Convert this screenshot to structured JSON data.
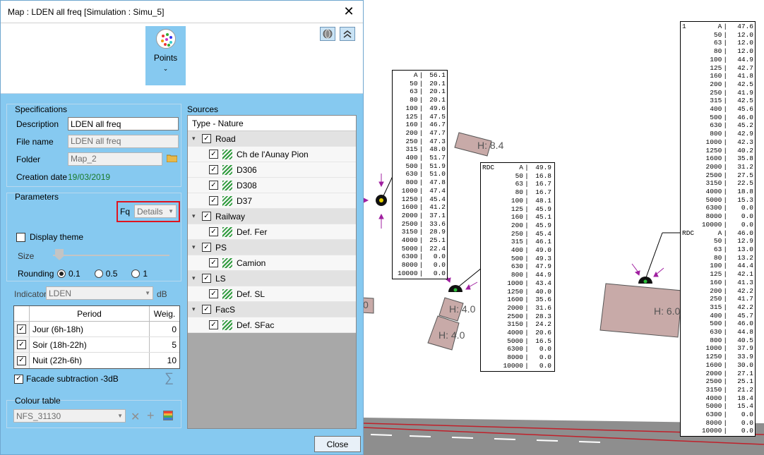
{
  "window": {
    "title": "Map : LDEN all freq [Simulation : Simu_5]",
    "close_glyph": "✕"
  },
  "ribbon": {
    "points_label": "Points",
    "points_chevron": "⌄",
    "icons": [
      "globe-icon",
      "collapse-up-icon"
    ]
  },
  "specifications": {
    "group_label": "Specifications",
    "description_label": "Description",
    "description_value": "LDEN all freq",
    "file_name_label": "File name",
    "file_name_value": "LDEN all freq",
    "folder_label": "Folder",
    "folder_value": "Map_2",
    "creation_date_label": "Creation date",
    "creation_date_value": "19/03/2019"
  },
  "parameters": {
    "group_label": "Parameters",
    "fq_label": "Fq",
    "fq_value": "Details",
    "display_theme_label": "Display theme",
    "size_label": "Size",
    "rounding_label": "Rounding",
    "rounding_options": [
      "0.1",
      "0.5",
      "1"
    ],
    "rounding_selected": "0.1"
  },
  "indicator": {
    "label": "Indicator",
    "value": "LDEN",
    "unit": "dB"
  },
  "periods": {
    "col_period": "Period",
    "col_weight": "Weig.",
    "rows": [
      {
        "name": "Jour (6h-18h)",
        "weight": "0",
        "checked": true
      },
      {
        "name": "Soir (18h-22h)",
        "weight": "5",
        "checked": true
      },
      {
        "name": "Nuit (22h-6h)",
        "weight": "10",
        "checked": true
      }
    ]
  },
  "facade": {
    "label": "Facade subtraction -3dB",
    "checked": true,
    "sigma": "∑"
  },
  "colour_table": {
    "group_label": "Colour table",
    "value": "NFS_31130"
  },
  "sources": {
    "group_label": "Sources",
    "header": "Type - Nature",
    "groups": [
      {
        "name": "Road",
        "children": [
          "Ch de l'Aunay Pion",
          "D306",
          "D308",
          "D37"
        ]
      },
      {
        "name": "Railway",
        "children": [
          "Def. Fer"
        ]
      },
      {
        "name": "PS",
        "children": [
          "Camion"
        ]
      },
      {
        "name": "LS",
        "children": [
          "Def. SL"
        ]
      },
      {
        "name": "FacS",
        "children": [
          "Def. SFac"
        ]
      }
    ]
  },
  "close_button": "Close",
  "map": {
    "labels": [
      "H: 8.4",
      "H: 4.0",
      "H: 4.0",
      "H: 6.0",
      "0"
    ],
    "table_a": {
      "rows": [
        [
          "A",
          "56.1"
        ],
        [
          "50",
          "20.1"
        ],
        [
          "63",
          "20.1"
        ],
        [
          "80",
          "20.1"
        ],
        [
          "100",
          "49.6"
        ],
        [
          "125",
          "47.5"
        ],
        [
          "160",
          "46.7"
        ],
        [
          "200",
          "47.7"
        ],
        [
          "250",
          "47.3"
        ],
        [
          "315",
          "48.0"
        ],
        [
          "400",
          "51.7"
        ],
        [
          "500",
          "51.9"
        ],
        [
          "630",
          "51.0"
        ],
        [
          "800",
          "47.8"
        ],
        [
          "1000",
          "47.4"
        ],
        [
          "1250",
          "45.4"
        ],
        [
          "1600",
          "41.2"
        ],
        [
          "2000",
          "37.1"
        ],
        [
          "2500",
          "33.6"
        ],
        [
          "3150",
          "28.9"
        ],
        [
          "4000",
          "25.1"
        ],
        [
          "5000",
          "22.4"
        ],
        [
          "6300",
          "0.0"
        ],
        [
          "8000",
          "0.0"
        ],
        [
          "10000",
          "0.0"
        ]
      ]
    },
    "table_b": {
      "level": "RDC",
      "rows": [
        [
          "A",
          "49.9"
        ],
        [
          "50",
          "16.8"
        ],
        [
          "63",
          "16.7"
        ],
        [
          "80",
          "16.7"
        ],
        [
          "100",
          "48.1"
        ],
        [
          "125",
          "45.9"
        ],
        [
          "160",
          "45.1"
        ],
        [
          "200",
          "45.9"
        ],
        [
          "250",
          "45.4"
        ],
        [
          "315",
          "46.1"
        ],
        [
          "400",
          "49.0"
        ],
        [
          "500",
          "49.3"
        ],
        [
          "630",
          "47.9"
        ],
        [
          "800",
          "44.9"
        ],
        [
          "1000",
          "43.4"
        ],
        [
          "1250",
          "40.0"
        ],
        [
          "1600",
          "35.6"
        ],
        [
          "2000",
          "31.6"
        ],
        [
          "2500",
          "28.3"
        ],
        [
          "3150",
          "24.2"
        ],
        [
          "4000",
          "20.6"
        ],
        [
          "5000",
          "16.5"
        ],
        [
          "6300",
          "0.0"
        ],
        [
          "8000",
          "0.0"
        ],
        [
          "10000",
          "0.0"
        ]
      ]
    },
    "table_c": {
      "level1": "1",
      "rows1": [
        [
          "A",
          "47.6"
        ],
        [
          "50",
          "12.0"
        ],
        [
          "63",
          "12.0"
        ],
        [
          "80",
          "12.0"
        ],
        [
          "100",
          "44.9"
        ],
        [
          "125",
          "42.7"
        ],
        [
          "160",
          "41.8"
        ],
        [
          "200",
          "42.5"
        ],
        [
          "250",
          "41.9"
        ],
        [
          "315",
          "42.5"
        ],
        [
          "400",
          "45.6"
        ],
        [
          "500",
          "46.0"
        ],
        [
          "630",
          "45.2"
        ],
        [
          "800",
          "42.9"
        ],
        [
          "1000",
          "42.3"
        ],
        [
          "1250",
          "40.2"
        ],
        [
          "1600",
          "35.8"
        ],
        [
          "2000",
          "31.2"
        ],
        [
          "2500",
          "27.5"
        ],
        [
          "3150",
          "22.5"
        ],
        [
          "4000",
          "18.8"
        ],
        [
          "5000",
          "15.3"
        ],
        [
          "6300",
          "0.0"
        ],
        [
          "8000",
          "0.0"
        ],
        [
          "10000",
          "0.0"
        ]
      ],
      "level2": "RDC",
      "rows2": [
        [
          "A",
          "46.0"
        ],
        [
          "50",
          "12.9"
        ],
        [
          "63",
          "13.0"
        ],
        [
          "80",
          "13.2"
        ],
        [
          "100",
          "44.4"
        ],
        [
          "125",
          "42.1"
        ],
        [
          "160",
          "41.3"
        ],
        [
          "200",
          "42.2"
        ],
        [
          "250",
          "41.7"
        ],
        [
          "315",
          "42.2"
        ],
        [
          "400",
          "45.7"
        ],
        [
          "500",
          "46.0"
        ],
        [
          "630",
          "44.8"
        ],
        [
          "800",
          "40.5"
        ],
        [
          "1000",
          "37.9"
        ],
        [
          "1250",
          "33.9"
        ],
        [
          "1600",
          "30.0"
        ],
        [
          "2000",
          "27.1"
        ],
        [
          "2500",
          "25.1"
        ],
        [
          "3150",
          "21.2"
        ],
        [
          "4000",
          "18.4"
        ],
        [
          "5000",
          "15.4"
        ],
        [
          "6300",
          "0.0"
        ],
        [
          "8000",
          "0.0"
        ],
        [
          "10000",
          "0.0"
        ]
      ]
    }
  }
}
